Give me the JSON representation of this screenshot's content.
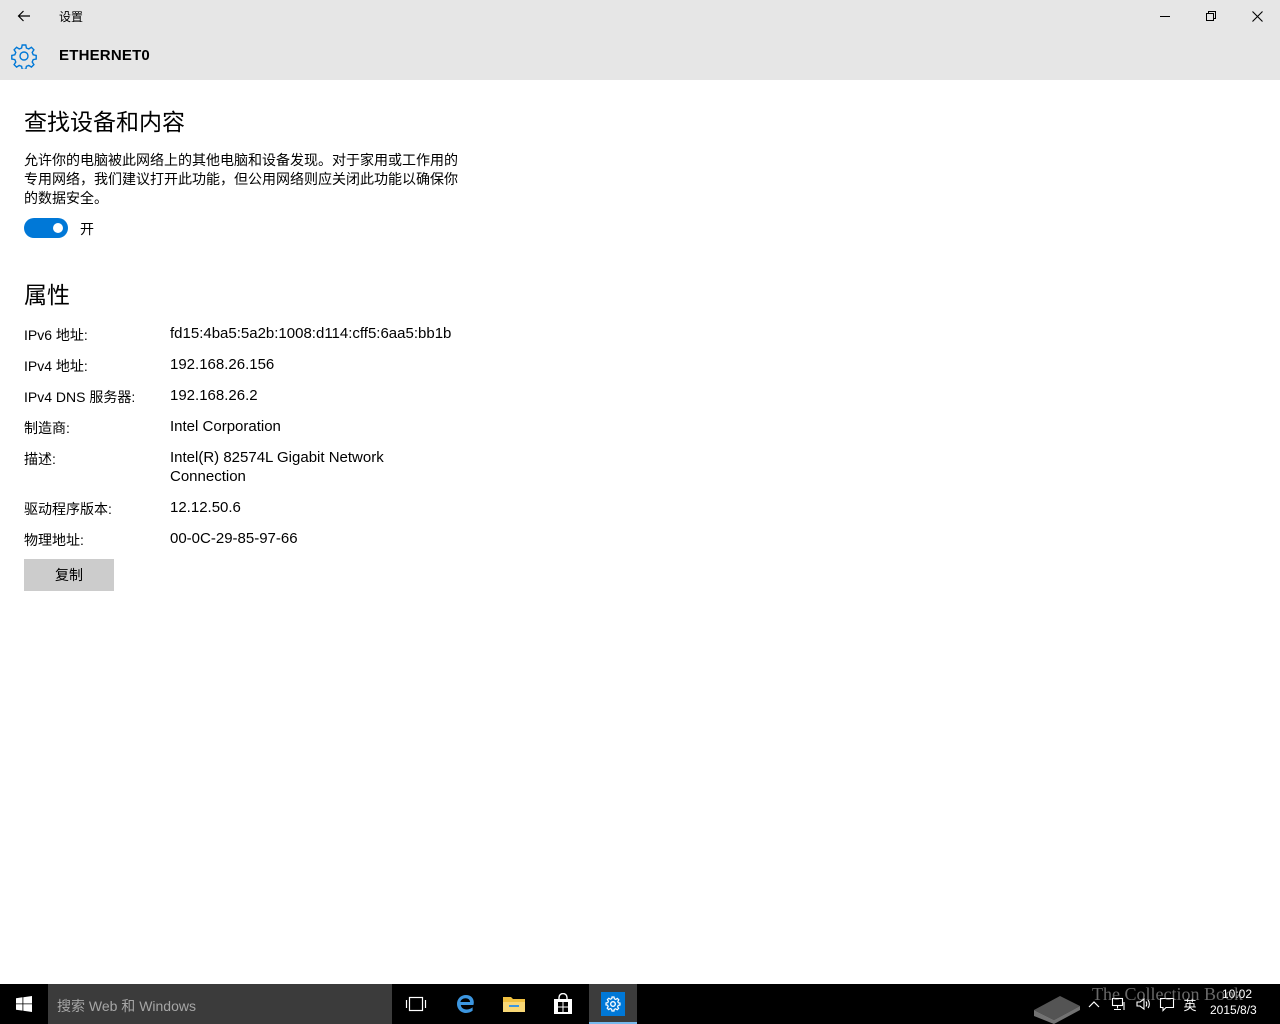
{
  "window": {
    "app_title": "设置"
  },
  "header": {
    "title": "ETHERNET0"
  },
  "discovery": {
    "title": "查找设备和内容",
    "description": "允许你的电脑被此网络上的其他电脑和设备发现。对于家用或工作用的专用网络，我们建议打开此功能，但公用网络则应关闭此功能以确保你的数据安全。",
    "toggle_state": "开",
    "toggle_on": true
  },
  "properties": {
    "title": "属性",
    "rows": [
      {
        "label": "IPv6 地址:",
        "value": "fd15:4ba5:5a2b:1008:d114:cff5:6aa5:bb1b"
      },
      {
        "label": "IPv4 地址:",
        "value": "192.168.26.156"
      },
      {
        "label": "IPv4 DNS 服务器:",
        "value": "192.168.26.2"
      },
      {
        "label": "制造商:",
        "value": "Intel Corporation"
      },
      {
        "label": "描述:",
        "value": "Intel(R) 82574L Gigabit Network Connection"
      },
      {
        "label": "驱动程序版本:",
        "value": "12.12.50.6"
      },
      {
        "label": "物理地址:",
        "value": "00-0C-29-85-97-66"
      }
    ],
    "copy_button": "复制"
  },
  "taskbar": {
    "search_placeholder": "搜索 Web 和 Windows",
    "apps": [
      "task-view-icon",
      "edge-icon",
      "file-explorer-icon",
      "store-icon",
      "settings-icon"
    ],
    "active_app": "settings-icon",
    "ime_label": "英",
    "time": "10:02",
    "date": "2015/8/3"
  },
  "watermark": {
    "text": "The Collection Book"
  },
  "colors": {
    "accent": "#0078d7",
    "chrome": "#e6e6e6",
    "taskbar": "#000000"
  }
}
